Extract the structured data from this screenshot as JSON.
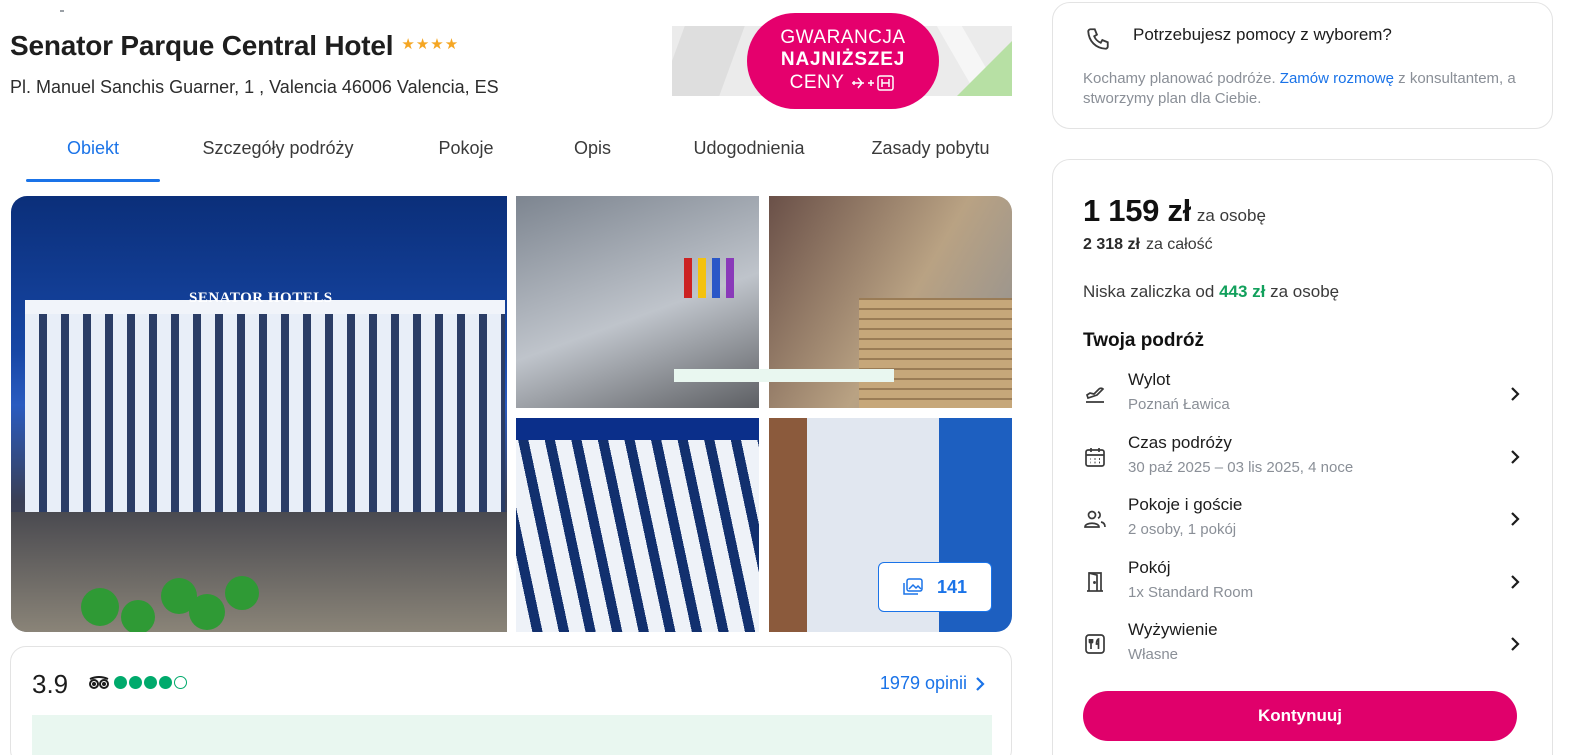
{
  "hotel": {
    "name": "Senator Parque Central Hotel",
    "star_count": 4,
    "address": "Pl. Manuel Sanchis Guarner, 1 , Valencia 46006 Valencia, ES"
  },
  "guarantee_badge": {
    "line1": "GWARANCJA",
    "line2": "NAJNIŻSZEJ",
    "line3": "CENY",
    "icon": "plane-plus-hotel-icon"
  },
  "tabs": [
    {
      "label": "Obiekt",
      "active": true
    },
    {
      "label": "Szczegóły podróży",
      "active": false
    },
    {
      "label": "Pokoje",
      "active": false
    },
    {
      "label": "Opis",
      "active": false
    },
    {
      "label": "Udogodnienia",
      "active": false
    },
    {
      "label": "Zasady pobytu",
      "active": false
    }
  ],
  "gallery": {
    "main_sign": "SENATOR HOTELS",
    "photo_count": "141"
  },
  "reviews": {
    "score": "3.9",
    "bubbles_filled": 4,
    "bubbles_total": 5,
    "link_label": "1979 opinii"
  },
  "help": {
    "title": "Potrzebujesz pomocy z wyborem?",
    "text_before": "Kochamy planować podróże. ",
    "link": "Zamów rozmowę",
    "text_after": " z konsultantem, a stworzymy plan dla Ciebie."
  },
  "price": {
    "per_person": "1 159 zł",
    "per_person_label": "za osobę",
    "total": "2 318 zł",
    "total_label": "za całość",
    "deposit_prefix": "Niska zaliczka od",
    "deposit_amount": "443 zł",
    "deposit_suffix": "za osobę"
  },
  "trip": {
    "title": "Twoja podróż",
    "rows": [
      {
        "label": "Wylot",
        "value": "Poznań Ławica",
        "icon": "plane-departure-icon"
      },
      {
        "label": "Czas podróży",
        "value": "30 paź 2025 – 03 lis 2025, 4 noce",
        "icon": "calendar-icon"
      },
      {
        "label": "Pokoje i goście",
        "value": "2 osoby, 1 pokój",
        "icon": "guests-icon"
      },
      {
        "label": "Pokój",
        "value": "1x Standard Room",
        "icon": "door-icon"
      },
      {
        "label": "Wyżywienie",
        "value": "Własne",
        "icon": "cutlery-icon"
      }
    ]
  },
  "cta": {
    "label": "Kontynuuj"
  },
  "colors": {
    "brand_pink": "#e5006d",
    "link_blue": "#1a73e8",
    "deposit_green": "#12a05c",
    "star_orange": "#f5a623",
    "tripadvisor_green": "#00aa6c"
  }
}
